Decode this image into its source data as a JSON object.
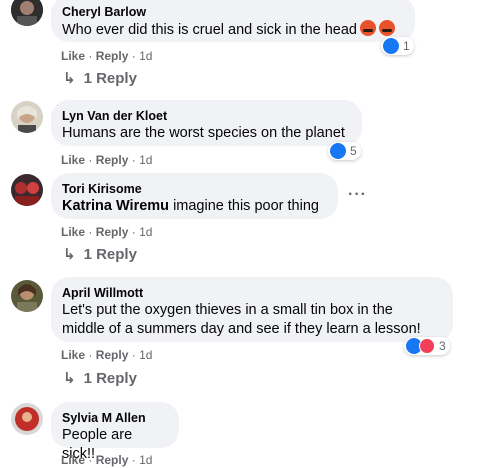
{
  "comments": [
    {
      "author": "Cheryl Barlow",
      "text": "Who ever did this is cruel and sick in the head",
      "emojis": [
        "angry-face-icon",
        "angry-face-icon"
      ],
      "like": "Like",
      "reply": "Reply",
      "time": "1d",
      "reactions": "1",
      "reply_count": "1 Reply",
      "avatar_color": "#3a3a3a"
    },
    {
      "author": "Lyn Van der Kloet",
      "text": "Humans are the worst species on the planet",
      "like": "Like",
      "reply": "Reply",
      "time": "1d",
      "reactions": "5",
      "avatar_color": "#c8c0b0"
    },
    {
      "author": "Tori Kirisome",
      "mention": "Katrina Wiremu",
      "text": "imagine this poor thing",
      "like": "Like",
      "reply": "Reply",
      "time": "1d",
      "reply_count": "1 Reply",
      "avatar_color": "#8a2a2a"
    },
    {
      "author": "April Willmott",
      "text_line1": "Let's put the oxygen thieves in a small tin box in the",
      "text_line2": "middle of a summers day and see if they learn a lesson!",
      "like": "Like",
      "reply": "Reply",
      "time": "1d",
      "reactions": "3",
      "reply_count": "1 Reply",
      "avatar_color": "#6b6a4a"
    },
    {
      "author": "Sylvia M Allen",
      "text": "People are sick!!",
      "like": "Like",
      "reply": "Reply",
      "time": "1d",
      "avatar_color": "#b0302a"
    }
  ],
  "separator": "·",
  "more_icon": "more-options-icon",
  "colors": {
    "like_blue": "#1877f2",
    "love_red": "#f33e58",
    "bubble": "#f0f2f5",
    "muted": "#65676b"
  }
}
